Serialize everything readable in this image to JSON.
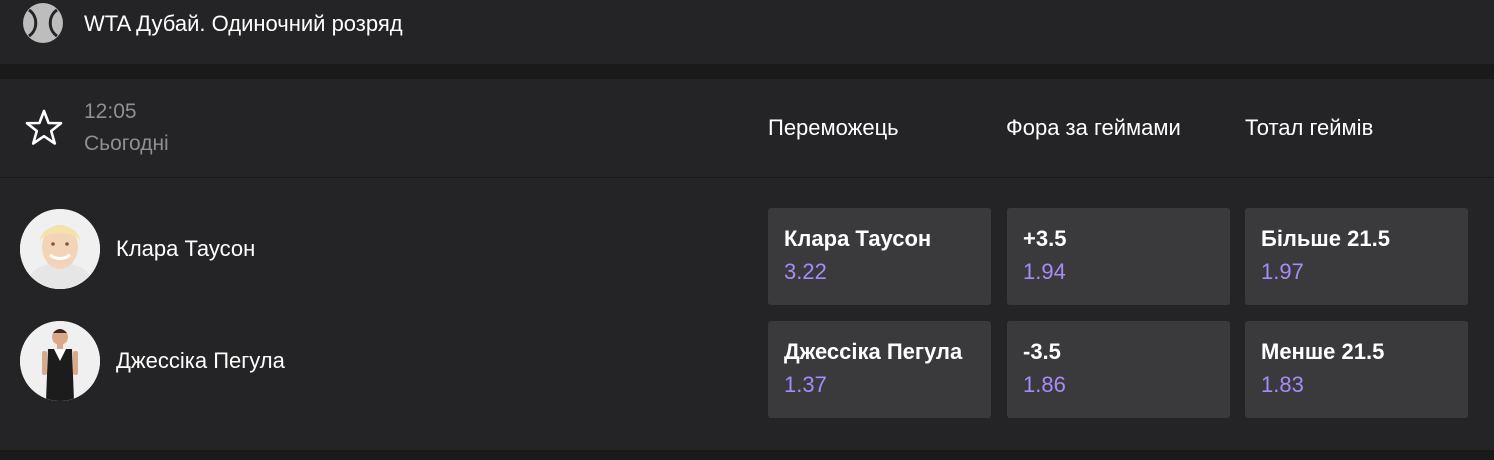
{
  "header": {
    "title": "WTA Дубай. Одиночний розряд",
    "icon": "tennis-ball-icon"
  },
  "match": {
    "time": "12:05",
    "date": "Сьогодні",
    "favorite_icon": "star-icon",
    "columns": [
      "Переможець",
      "Фора за геймами",
      "Тотал геймів"
    ],
    "players": [
      {
        "name": "Клара Таусон",
        "odds": [
          {
            "label": "Клара Таусон",
            "value": "3.22"
          },
          {
            "label": "+3.5",
            "value": "1.94"
          },
          {
            "label": "Більше 21.5",
            "value": "1.97"
          }
        ]
      },
      {
        "name": "Джессіка Пегула",
        "odds": [
          {
            "label": "Джессіка Пегула",
            "value": "1.37"
          },
          {
            "label": "-3.5",
            "value": "1.86"
          },
          {
            "label": "Менше 21.5",
            "value": "1.83"
          }
        ]
      }
    ]
  },
  "colors": {
    "odds_value": "#a78bfa",
    "card_bg": "#242426",
    "button_bg": "#3a3a3c"
  }
}
